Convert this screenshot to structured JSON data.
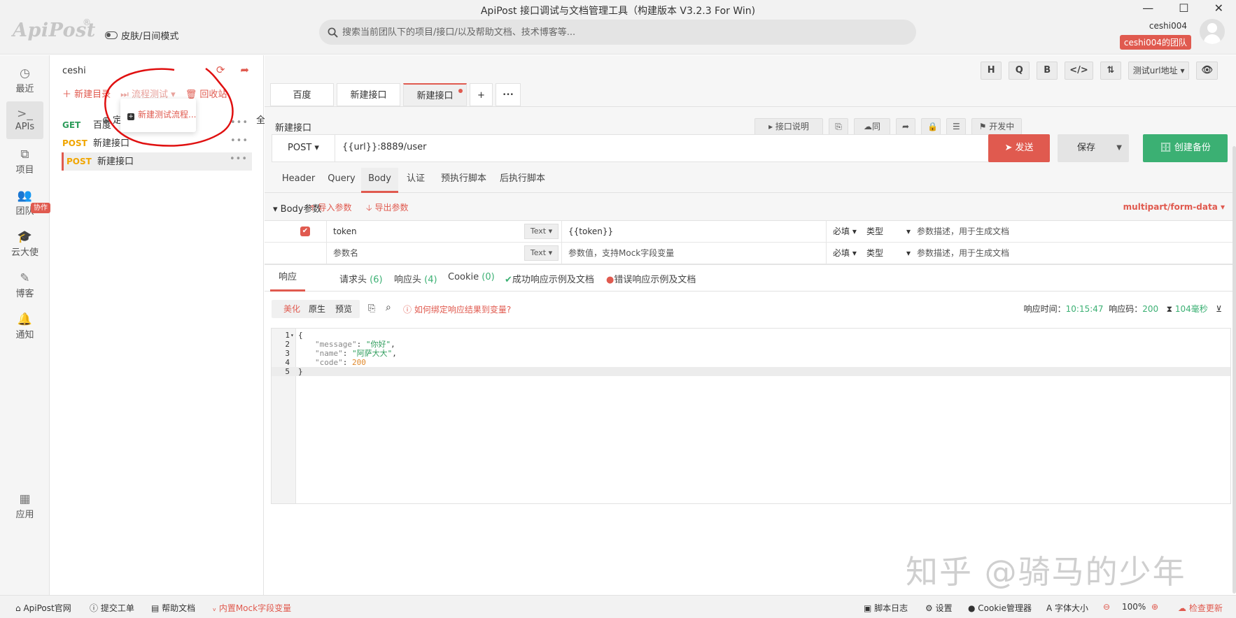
{
  "window": {
    "title": "ApiPost 接口调试与文档管理工具（构建版本 V3.2.3 For Win)",
    "logo": "ApiPost",
    "logo_mark": "®",
    "minimize": "—",
    "maximize": "☐",
    "close": "✕"
  },
  "header": {
    "skin_mode": "皮肤/日间模式",
    "search_placeholder": "搜索当前团队下的项目/接口/以及帮助文档、技术博客等...",
    "user_name": "ceshi004",
    "team": "ceshi004的团队"
  },
  "leftnav": {
    "items": [
      {
        "label": "最近",
        "icon": "clock-icon"
      },
      {
        "label": "APIs",
        "icon": "terminal-icon"
      },
      {
        "label": "项目",
        "icon": "project-icon"
      },
      {
        "label": "团队",
        "icon": "team-icon"
      },
      {
        "label": "云大使",
        "icon": "graduation-cap-icon"
      },
      {
        "label": "博客",
        "icon": "edit-icon"
      },
      {
        "label": "通知",
        "icon": "bell-icon"
      },
      {
        "label": "应用",
        "icon": "apps-grid-icon"
      }
    ],
    "team_badge": "协作"
  },
  "tree": {
    "project": "ceshi",
    "new_folder": "新建目录",
    "flow_test": "流程测试",
    "recycle": "回收站",
    "locate": "定",
    "collapse_all": "全部收起",
    "popup_item": "新建测试流程...",
    "rows": [
      {
        "method": "GET",
        "name": "百度"
      },
      {
        "method": "POST",
        "name": "新建接口"
      },
      {
        "method": "POST",
        "name": "新建接口"
      }
    ]
  },
  "toolbar": {
    "h": "H",
    "q": "Q",
    "b": "B",
    "code": "</>",
    "sliders": "⇅",
    "url_select": "测试url地址",
    "eye": "👁"
  },
  "tabs": [
    {
      "label": "百度"
    },
    {
      "label": "新建接口"
    },
    {
      "label": "新建接口"
    }
  ],
  "tab_add": "+",
  "tab_more": "•••",
  "interface": {
    "name": "新建接口",
    "doc_btn": "接口说明",
    "sync_btn": "同步",
    "status": "开发中"
  },
  "request": {
    "method": "POST",
    "url": "{{url}}:8889/user",
    "send": "发送",
    "save": "保存",
    "backup": "创建备份"
  },
  "req_tabs": [
    "Header",
    "Query",
    "Body",
    "认证",
    "预执行脚本",
    "后执行脚本"
  ],
  "body": {
    "title": "Body参数",
    "import": "导入参数",
    "export": "导出参数",
    "content_type": "multipart/form-data",
    "params": [
      {
        "checked": "✔",
        "key": "token",
        "type": "Text",
        "value": "{{token}}",
        "required": "必填",
        "vtype": "类型",
        "desc": "参数描述，用于生成文档"
      },
      {
        "checked": "",
        "key": "参数名",
        "type": "Text",
        "value": "参数值，支持Mock字段变量",
        "required": "必填",
        "vtype": "类型",
        "desc": "参数描述，用于生成文档"
      }
    ]
  },
  "response": {
    "tabs": [
      {
        "label": "响应"
      },
      {
        "label": "请求头",
        "count": "(6)"
      },
      {
        "label": "响应头",
        "count": "(4)"
      },
      {
        "label": "Cookie",
        "count": "(0)"
      },
      {
        "label": "成功响应示例及文档"
      },
      {
        "label": "错误响应示例及文档"
      }
    ],
    "views": [
      "美化",
      "原生",
      "预览"
    ],
    "help": "如何绑定响应结果到变量?",
    "time_label": "响应时间：",
    "time": "10:15:47",
    "code_label": "响应码：",
    "code": "200",
    "duration": "104毫秒",
    "lines": [
      {
        "n": "1",
        "text": "{"
      },
      {
        "n": "2",
        "key": "\"message\"",
        "val": "\"你好\"",
        "end": ","
      },
      {
        "n": "3",
        "key": "\"name\"",
        "val": "\"阿萨大大\"",
        "end": ","
      },
      {
        "n": "4",
        "key": "\"code\"",
        "num": "200",
        "end": ""
      },
      {
        "n": "5",
        "text": "}"
      }
    ]
  },
  "footer": {
    "official": "ApiPost官网",
    "ticket": "提交工单",
    "help": "帮助文档",
    "mock": "内置Mock字段变量",
    "script_log": "脚本日志",
    "settings": "设置",
    "cookie": "Cookie管理器",
    "font_size": "字体大小",
    "zoom": "100%",
    "update": "检查更新"
  },
  "watermark": "知乎 @骑马的少年",
  "colors": {
    "accent": "#e05a4f",
    "green": "#3bb073",
    "post": "#f0a500"
  }
}
